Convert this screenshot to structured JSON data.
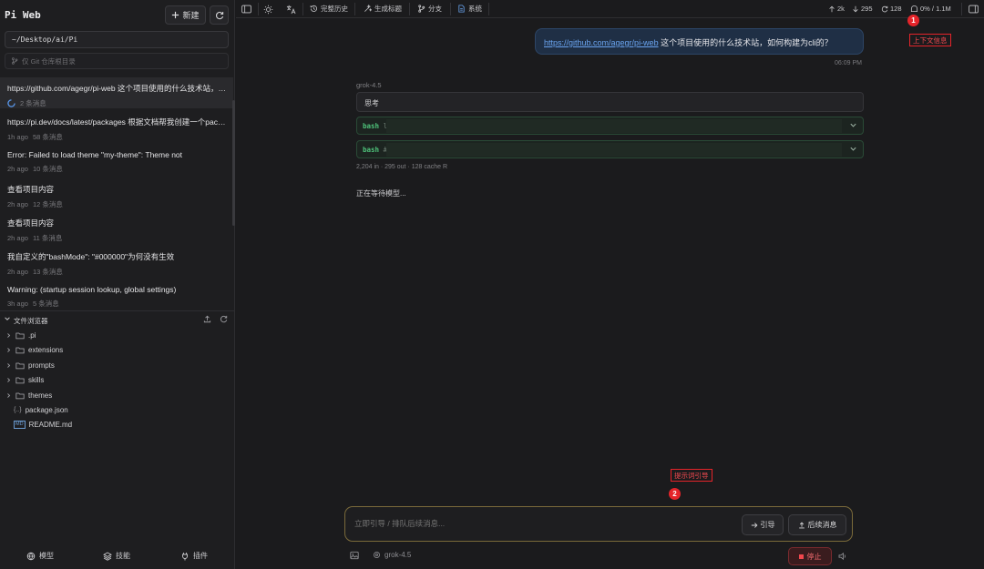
{
  "app": {
    "title": "Pi Web"
  },
  "sidebar": {
    "new_label": "新建",
    "path_value": "~/Desktop/ai/Pi",
    "git_root_placeholder": "仅 Git 仓库根目录",
    "sessions": [
      {
        "title": "https://github.com/agegr/pi-web 这个项目使用的什么技术站，如何构建为cli的？",
        "time": "",
        "count": "2 条消息",
        "active": true
      },
      {
        "title": "https://pi.dev/docs/latest/packages 根据文档帮我创建一个package",
        "time": "1h ago",
        "count": "58 条消息"
      },
      {
        "title": "Error: Failed to load theme \"my-theme\": Theme not",
        "time": "2h ago",
        "count": "10 条消息"
      },
      {
        "title": "查看项目内容",
        "time": "2h ago",
        "count": "12 条消息"
      },
      {
        "title": "查看项目内容",
        "time": "2h ago",
        "count": "11 条消息"
      },
      {
        "title": "我自定义的\"bashMode\": \"#000000\"为何没有生效",
        "time": "2h ago",
        "count": "13 条消息"
      },
      {
        "title": "Warning: (startup session lookup, global settings)",
        "time": "3h ago",
        "count": "5 条消息"
      }
    ],
    "file_browser_label": "文件浏览器",
    "files": [
      {
        "name": ".pi",
        "type": "folder"
      },
      {
        "name": "extensions",
        "type": "folder"
      },
      {
        "name": "prompts",
        "type": "folder"
      },
      {
        "name": "skills",
        "type": "folder"
      },
      {
        "name": "themes",
        "type": "folder"
      },
      {
        "name": "package.json",
        "type": "json"
      },
      {
        "name": "README.md",
        "type": "md"
      }
    ],
    "footer": {
      "models": "模型",
      "skills": "技能",
      "plugins": "插件"
    }
  },
  "topbar": {
    "full_history": "完整历史",
    "gen_title": "生成标题",
    "branch": "分支",
    "system": "系统",
    "stat_up": "2k",
    "stat_down": "295",
    "stat_cache": "128",
    "stat_context": "0% / 1.1M"
  },
  "chat": {
    "user_link": "https://github.com/agegr/pi-web",
    "user_text": " 这个项目使用的什么技术站，如何构建为cli的？",
    "user_time": "06:09 PM",
    "model": "grok-4.5",
    "thinking": "思考",
    "bash_label_1": "bash",
    "bash_prefix_1": "l",
    "bash_label_2": "bash",
    "bash_prefix_2": "#",
    "token_info": "2,204 in · 295 out · 128 cache R",
    "waiting": "正在等待模型..."
  },
  "annotations": {
    "a1_num": "1",
    "a1_label": "上下文信息",
    "a2_num": "2",
    "a2_label": "提示词引导",
    "color": "#e5242a"
  },
  "composer": {
    "placeholder": "立即引导 / 排队后续消息...",
    "guide": "引导",
    "followup": "后续消息",
    "model": "grok-4.5",
    "stop": "停止"
  },
  "colors": {
    "accent_link": "#6aa4f0",
    "bash_green": "#4ec27a",
    "stop_red": "#f0474d"
  }
}
